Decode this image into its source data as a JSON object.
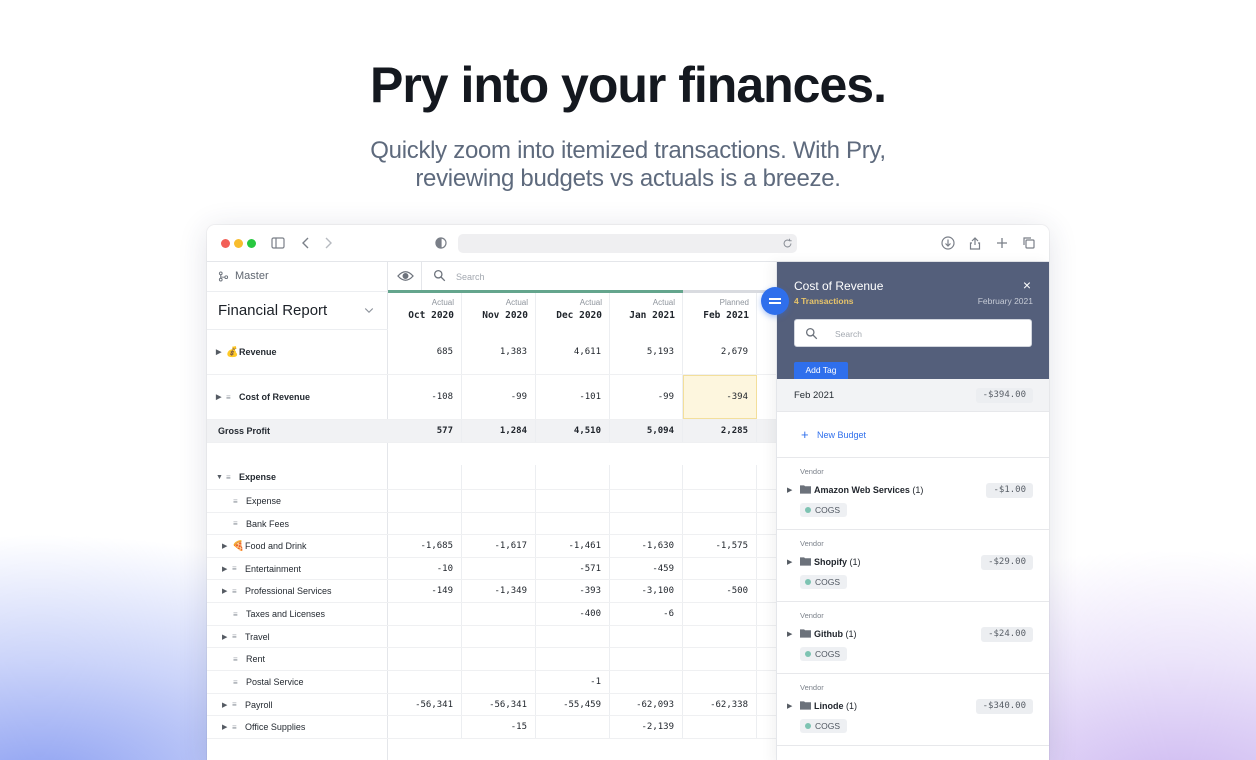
{
  "hero": {
    "headline": "Pry into your finances.",
    "subline_1": "Quickly zoom into itemized transactions. With Pry,",
    "subline_2": "reviewing budgets vs actuals is a breeze."
  },
  "colors": {
    "accent": "#2f6fec",
    "panel_header": "#545f7b",
    "progress_green": "#64a58d",
    "highlight_cell": "#fdf6de",
    "tag_dot": "#7dc3b2",
    "count_gold": "#e7c46a"
  },
  "sidebar": {
    "branch": "Master",
    "report_title": "Financial Report"
  },
  "grid": {
    "search_placeholder": "Search",
    "columns": [
      {
        "kind": "Actual",
        "month": "Oct 2020"
      },
      {
        "kind": "Actual",
        "month": "Nov 2020"
      },
      {
        "kind": "Actual",
        "month": "Dec 2020"
      },
      {
        "kind": "Actual",
        "month": "Jan 2021"
      },
      {
        "kind": "Planned",
        "month": "Feb 2021"
      }
    ],
    "rows": [
      {
        "label": "Revenue",
        "icon": "money-bag-icon",
        "values": [
          "685",
          "1,383",
          "4,611",
          "5,193",
          "2,679"
        ]
      },
      {
        "label": "Cost of Revenue",
        "icon": "lines-icon",
        "values": [
          "-108",
          "-99",
          "-101",
          "-99",
          "-394"
        ]
      },
      {
        "label": "Gross Profit",
        "icon": "",
        "values": [
          "577",
          "1,284",
          "4,510",
          "5,094",
          "2,285"
        ]
      },
      {
        "label": "Expense",
        "icon": "lines-icon",
        "values": [
          "",
          "",
          "",
          "",
          ""
        ]
      },
      {
        "label": "Expense",
        "icon": "lines-icon",
        "values": [
          "",
          "",
          "",
          "",
          ""
        ]
      },
      {
        "label": "Bank Fees",
        "icon": "lines-icon",
        "values": [
          "",
          "",
          "",
          "",
          ""
        ]
      },
      {
        "label": "Food and Drink",
        "icon": "pizza-icon",
        "values": [
          "-1,685",
          "-1,617",
          "-1,461",
          "-1,630",
          "-1,575"
        ]
      },
      {
        "label": "Entertainment",
        "icon": "lines-icon",
        "values": [
          "-10",
          "",
          "-571",
          "-459",
          ""
        ]
      },
      {
        "label": "Professional Services",
        "icon": "lines-icon",
        "values": [
          "-149",
          "-1,349",
          "-393",
          "-3,100",
          "-500"
        ]
      },
      {
        "label": "Taxes and Licenses",
        "icon": "lines-icon",
        "values": [
          "",
          "",
          "-400",
          "-6",
          ""
        ]
      },
      {
        "label": "Travel",
        "icon": "lines-icon",
        "values": [
          "",
          "",
          "",
          "",
          ""
        ]
      },
      {
        "label": "Rent",
        "icon": "lines-icon",
        "values": [
          "",
          "",
          "",
          "",
          ""
        ]
      },
      {
        "label": "Postal Service",
        "icon": "lines-icon",
        "values": [
          "",
          "",
          "-1",
          "",
          ""
        ]
      },
      {
        "label": "Payroll",
        "icon": "lines-icon",
        "values": [
          "-56,341",
          "-56,341",
          "-55,459",
          "-62,093",
          "-62,338"
        ]
      },
      {
        "label": "Office Supplies",
        "icon": "lines-icon",
        "values": [
          "",
          "-15",
          "",
          "-2,139",
          ""
        ]
      }
    ]
  },
  "panel": {
    "title": "Cost of Revenue",
    "count": "4 Transactions",
    "date": "February 2021",
    "close": "×",
    "search_placeholder": "Search",
    "add_tag": "Add Tag",
    "period_label": "Feb 2021",
    "period_amount": "-$394.00",
    "new_budget": "New Budget",
    "vendor_label": "Vendor",
    "vendors": [
      {
        "name": "Amazon Web Services",
        "count": "(1)",
        "amount": "-$1.00",
        "tag": "COGS"
      },
      {
        "name": "Shopify",
        "count": "(1)",
        "amount": "-$29.00",
        "tag": "COGS"
      },
      {
        "name": "Github",
        "count": "(1)",
        "amount": "-$24.00",
        "tag": "COGS"
      },
      {
        "name": "Linode",
        "count": "(1)",
        "amount": "-$340.00",
        "tag": "COGS"
      }
    ]
  }
}
